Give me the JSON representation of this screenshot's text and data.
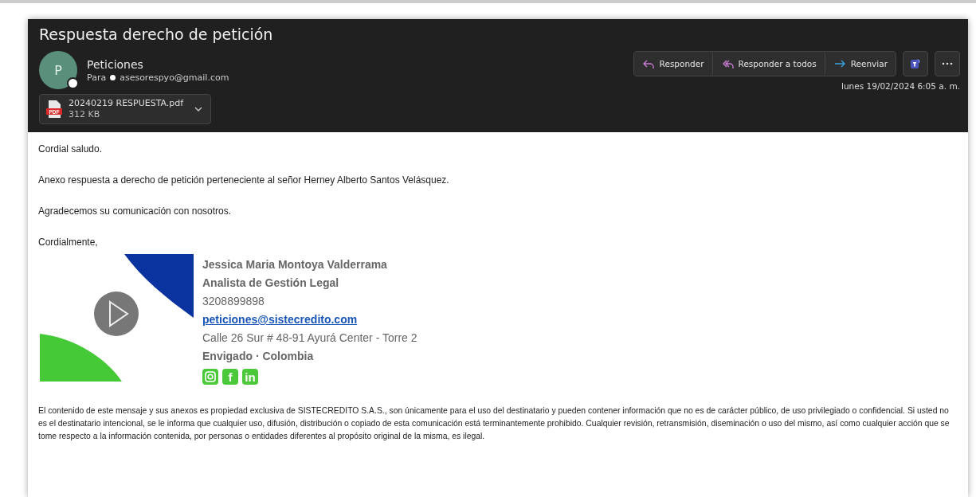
{
  "header": {
    "subject": "Respuesta derecho de petición",
    "sender": {
      "initial": "P",
      "name": "Peticiones",
      "to_label": "Para",
      "to_address": "asesorespyo@gmail.com"
    },
    "attachment": {
      "name": "20240219 RESPUESTA.pdf",
      "size": "312 KB",
      "badge": "PDF"
    },
    "actions": [
      {
        "kind": "reply",
        "label": "Responder"
      },
      {
        "kind": "reply-all",
        "label": "Responder a todos"
      },
      {
        "kind": "forward",
        "label": "Reenviar"
      },
      {
        "kind": "teams"
      },
      {
        "kind": "more"
      }
    ],
    "date": "lunes 19/02/2024 6:05 a. m."
  },
  "body": {
    "paragraphs": [
      "Cordial saludo.",
      "Anexo respuesta a derecho de petición perteneciente al señor Herney Alberto Santos Velásquez.",
      "Agradecemos su comunicación con nosotros."
    ],
    "signoff": "Cordialmente,"
  },
  "signature": {
    "lines": [
      {
        "kind": "bold",
        "text": "Jessica Maria Montoya Valderrama"
      },
      {
        "kind": "bold",
        "text": "Analista de Gestión Legal"
      },
      {
        "kind": "plain",
        "text": "3208899898"
      },
      {
        "kind": "link",
        "text": "peticiones@sistecredito.com"
      },
      {
        "kind": "plain",
        "text": "Calle 26 Sur # 48-91 Ayurá Center - Torre 2"
      },
      {
        "kind": "bold",
        "text": "Envigado · Colombia"
      }
    ],
    "social": [
      {
        "kind": "camera"
      },
      {
        "kind": "glyph",
        "label": "f"
      },
      {
        "kind": "glyph",
        "label": "in"
      }
    ]
  },
  "disclaimer": "El contenido de este mensaje y sus anexos es propiedad exclusiva de SISTECREDITO S.A.S., son únicamente para el uso del destinatario y pueden contener información que no es de carácter público, de uso privilegiado o confidencial. Si usted no es el destinatario intencional, se le informa que cualquier uso, difusión, distribución o copiado de esta comunicación está terminantemente prohibido. Cualquier revisión, retransmisión, diseminación o uso del mismo, así como cualquier acción que se tome respecto a la información contenida, por personas o entidades diferentes al propósito original de la misma, es ilegal."
}
